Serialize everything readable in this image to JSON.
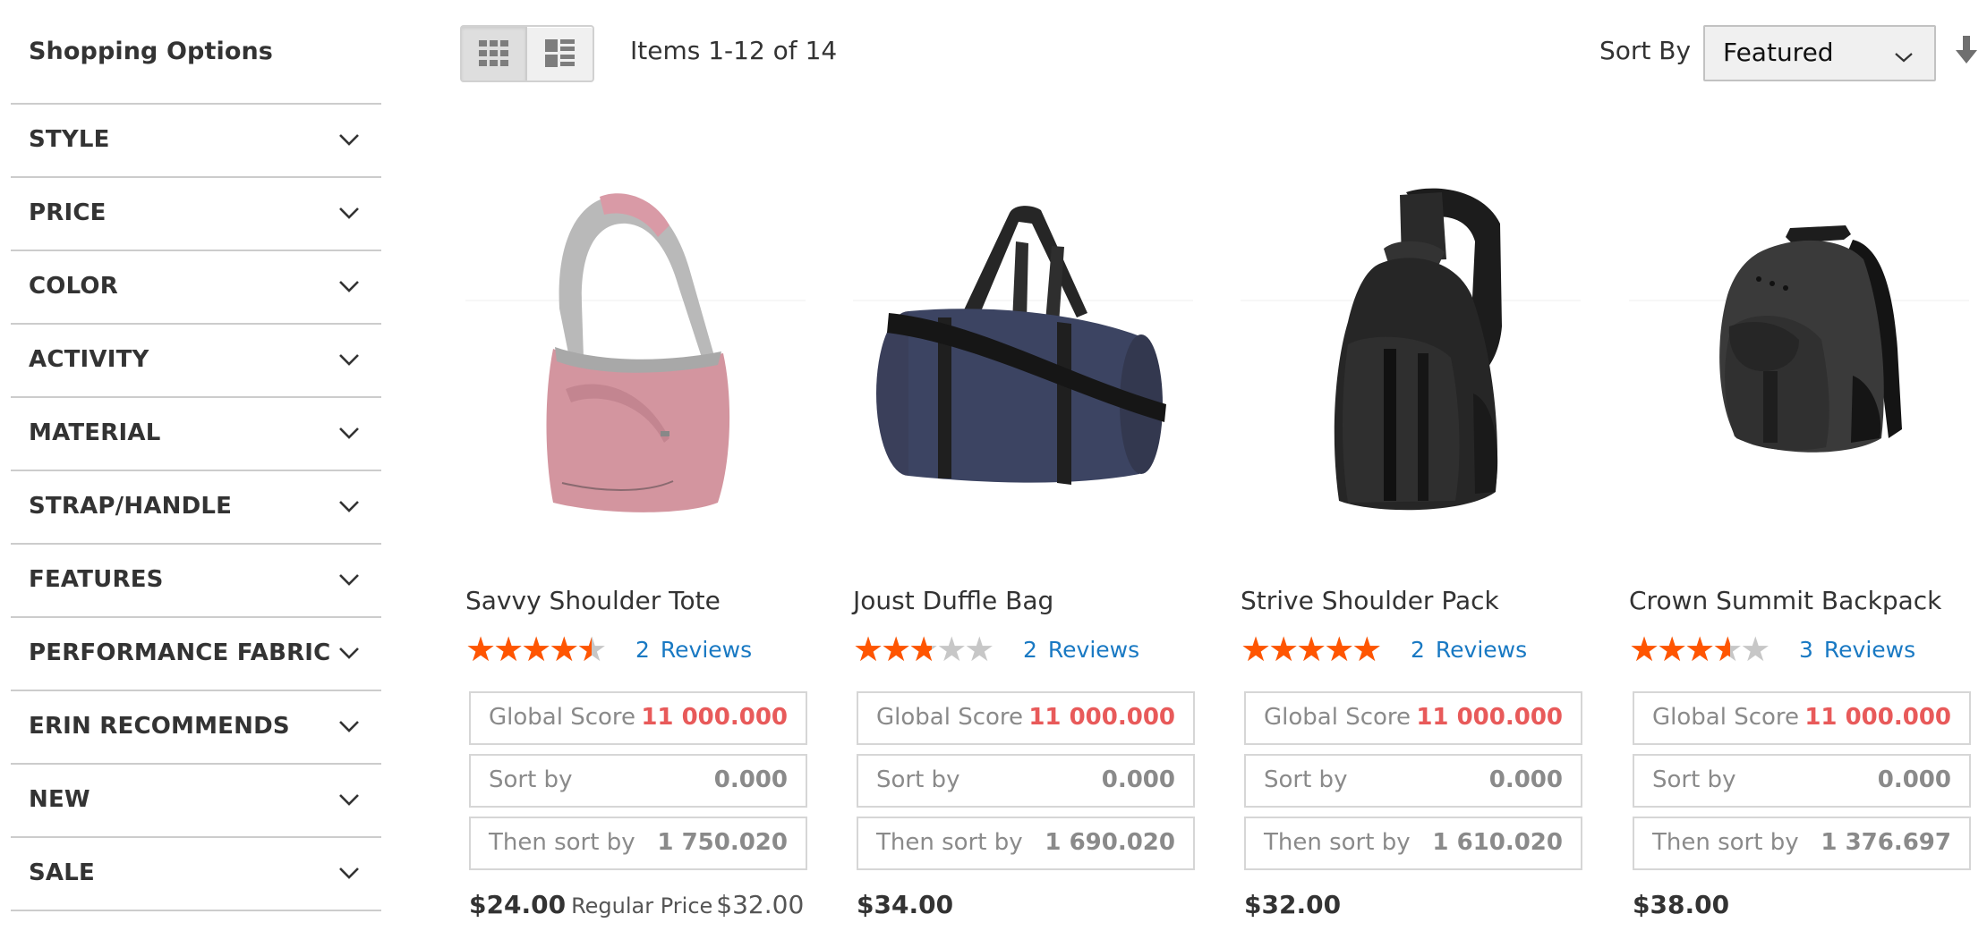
{
  "sidebar": {
    "title": "Shopping Options",
    "filters": [
      {
        "label": "STYLE"
      },
      {
        "label": "PRICE"
      },
      {
        "label": "COLOR"
      },
      {
        "label": "ACTIVITY"
      },
      {
        "label": "MATERIAL"
      },
      {
        "label": "STRAP/HANDLE"
      },
      {
        "label": "FEATURES"
      },
      {
        "label": "PERFORMANCE FABRIC"
      },
      {
        "label": "ERIN RECOMMENDS"
      },
      {
        "label": "NEW"
      },
      {
        "label": "SALE"
      }
    ]
  },
  "toolbar": {
    "view_modes": [
      {
        "name": "grid",
        "icon": "grid-icon",
        "active": true
      },
      {
        "name": "list",
        "icon": "list-icon",
        "active": false
      }
    ],
    "amount": "Items 1-12 of 14",
    "sort_label": "Sort By",
    "sort_value": "Featured",
    "sort_direction_icon": "arrow-down-icon"
  },
  "score_labels": {
    "global": "Global Score",
    "sort": "Sort by",
    "then": "Then sort by"
  },
  "colors": {
    "star_on": "#ff5501",
    "star_off": "#c7c7c7",
    "link": "#1979c3",
    "global_score": "#e85a5a"
  },
  "products": [
    {
      "name": "Savvy Shoulder Tote",
      "rating_percent": 80,
      "review_count": "2",
      "reviews_label": "Reviews",
      "global_score": "11 000.000",
      "sort_by": "0.000",
      "then_sort_by": "1 750.020",
      "price": "$24.00",
      "regular_price_label": "Regular Price",
      "regular_price": "$32.00",
      "image": "pink-shoulder-tote"
    },
    {
      "name": "Joust Duffle Bag",
      "rating_percent": 50,
      "review_count": "2",
      "reviews_label": "Reviews",
      "global_score": "11 000.000",
      "sort_by": "0.000",
      "then_sort_by": "1 690.020",
      "price": "$34.00",
      "image": "navy-duffle-bag"
    },
    {
      "name": "Strive Shoulder Pack",
      "rating_percent": 90,
      "review_count": "2",
      "reviews_label": "Reviews",
      "global_score": "11 000.000",
      "sort_by": "0.000",
      "then_sort_by": "1 610.020",
      "price": "$32.00",
      "image": "black-sling-pack"
    },
    {
      "name": "Crown Summit Backpack",
      "rating_percent": 64,
      "review_count": "3",
      "reviews_label": "Reviews",
      "global_score": "11 000.000",
      "sort_by": "0.000",
      "then_sort_by": "1 376.697",
      "price": "$38.00",
      "image": "dark-grey-backpack"
    }
  ]
}
